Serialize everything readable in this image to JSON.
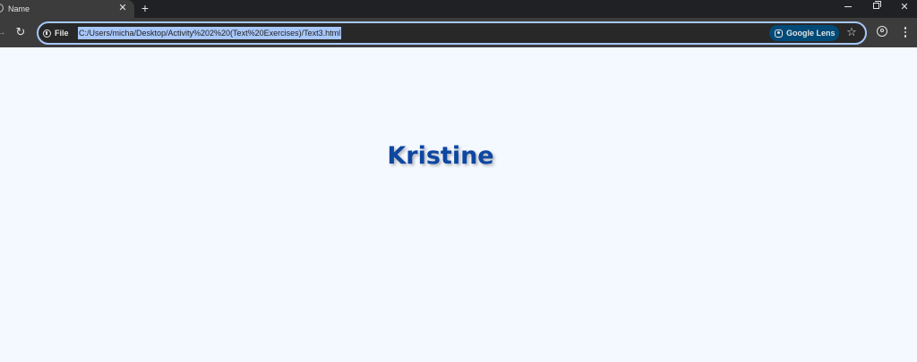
{
  "window": {
    "minimize_icon": "minimize-icon",
    "restore_icon": "restore-icon",
    "close_icon": "close-icon"
  },
  "tabs": [
    {
      "title": "Name",
      "active": true
    }
  ],
  "toolbar": {
    "site_info_label": "File",
    "url": "C:/Users/micha/Desktop/Activity%202%20(Text%20Exercises)/Text3.html",
    "lens_label": "Google Lens"
  },
  "page": {
    "heading": "Kristine",
    "heading_color": "#0d47a1",
    "background_color": "#f4f8ff"
  },
  "theme": {
    "chrome_dark": "#202124",
    "toolbar": "#3c3c3c",
    "omnibox_border": "#a8c7fa",
    "url_selection": "#a8c7fa",
    "lens_chip": "#004a77"
  }
}
